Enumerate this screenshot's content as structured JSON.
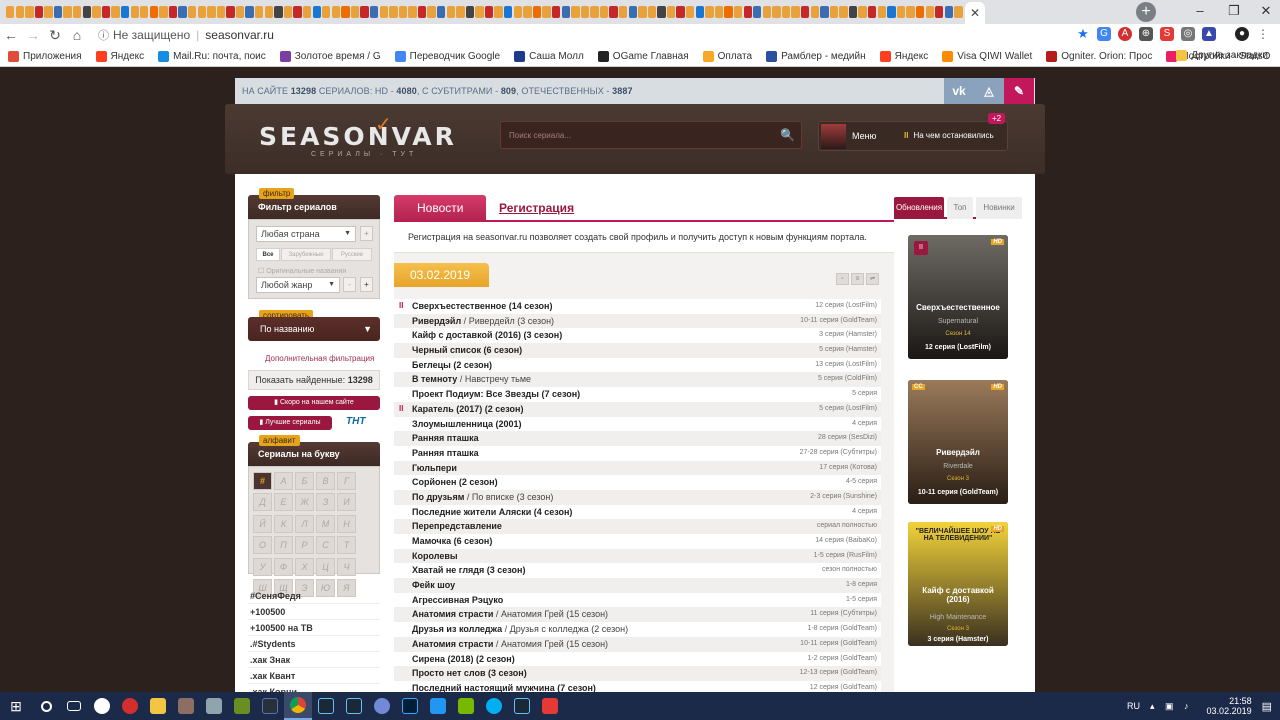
{
  "browser": {
    "url": "seasonvar.ru",
    "insecure_label": "Не защищено",
    "bookmarks": [
      {
        "label": "Приложения",
        "color": "#e04b3a"
      },
      {
        "label": "Яндекс",
        "color": "#fc3f1d"
      },
      {
        "label": "Mail.Ru: почта, поис",
        "color": "#168de2"
      },
      {
        "label": "Золотое время / G",
        "color": "#7a3ea3"
      },
      {
        "label": "Переводчик Google",
        "color": "#4285f4"
      },
      {
        "label": "Саша Молл",
        "color": "#1e3a8a"
      },
      {
        "label": "OGame Главная",
        "color": "#222"
      },
      {
        "label": "Оплата",
        "color": "#f9a825"
      },
      {
        "label": "Рамблер - медийн",
        "color": "#2b4fa0"
      },
      {
        "label": "Яндекс",
        "color": "#fc3f1d"
      },
      {
        "label": "Visa QIWI Wallet",
        "color": "#ff8c00"
      },
      {
        "label": "Ogniter. Orion: Прос",
        "color": "#b71c1c"
      },
      {
        "label": "Постройки - StarsO",
        "color": "#e91e63"
      }
    ],
    "other_bookmarks": "Другие закладки"
  },
  "site": {
    "stats": {
      "prefix": "НА САЙТЕ",
      "total": "13298",
      "t1": "СЕРИАЛОВ: HD -",
      "hd": "4080",
      "t2": ", С СУБТИТРАМИ -",
      "subs": "809",
      "t3": ", ОТЕЧЕСТВЕННЫХ -",
      "domestic": "3887"
    },
    "logo": "SEASONVAR",
    "logo_sub": "СЕРИАЛЫ · ТУТ",
    "search_placeholder": "Поиск сериала...",
    "menu_label": "Меню",
    "stopped_label": "На чем остановились",
    "badge": "+2"
  },
  "sidebar": {
    "filter_tag": "фильтр",
    "filter_title": "Фильтр сериалов",
    "country_select": "Любая страна",
    "seg_all": "Все",
    "seg_foreign": "Зарубежные",
    "seg_russian": "Русские",
    "original_names": "Оригинальные названия",
    "genre_select": "Любой жанр",
    "sort_tag": "сортировать",
    "sort_value": "По названию",
    "advanced_filter": "Дополнительная фильтрация",
    "found_label": "Показать найденные:",
    "found_count": "13298",
    "soon_button": "Скоро на нашем сайте",
    "best_button": "Лучшие сериалы",
    "tnt": "ТНТ",
    "alpha_tag": "алфавит",
    "alpha_title": "Сериалы на букву",
    "letters": [
      "#",
      "А",
      "Б",
      "В",
      "Г",
      "Д",
      "Е",
      "Ж",
      "З",
      "И",
      "Й",
      "К",
      "Л",
      "М",
      "Н",
      "О",
      "П",
      "Р",
      "С",
      "Т",
      "У",
      "Ф",
      "Х",
      "Ц",
      "Ч",
      "Ш",
      "Щ",
      "Э",
      "Ю",
      "Я"
    ],
    "tags": [
      "#СеняФедя",
      "+100500",
      "+100500 на ТВ",
      ".#Stydents",
      ".хак Знак",
      ".хак Квант",
      ".хак Корни"
    ]
  },
  "center": {
    "tab_news": "Новости",
    "tab_registration": "Регистрация",
    "registration_text": "Регистрация на seasonvar.ru позволяет создать свой профиль и получить доступ к новым функциям портала.",
    "date": "03.02.2019",
    "episodes": [
      {
        "title": "Сверхъестественное (14 сезон)",
        "alt": "",
        "info": "12 серия (LostFilm)",
        "paused": true
      },
      {
        "title": "Ривердэйл",
        "alt": "Ривердейл (3 сезон)",
        "info": "10-11 серия (GoldTeam)",
        "paused": false
      },
      {
        "title": "Кайф с доставкой (2016) (3 сезон)",
        "alt": "",
        "info": "3 серия (Hamster)",
        "paused": false
      },
      {
        "title": "Черный список (6 сезон)",
        "alt": "",
        "info": "5 серия (Hamster)",
        "paused": false
      },
      {
        "title": "Беглецы (2 сезон)",
        "alt": "",
        "info": "13 серия (LostFilm)",
        "paused": false
      },
      {
        "title": "В темноту",
        "alt": "Навстречу тьме",
        "info": "5 серия (ColdFilm)",
        "paused": false
      },
      {
        "title": "Проект Подиум: Все Звезды (7 сезон)",
        "alt": "",
        "info": "5 серия",
        "paused": false
      },
      {
        "title": "Каратель (2017) (2 сезон)",
        "alt": "",
        "info": "5 серия (LostFilm)",
        "paused": true
      },
      {
        "title": "Злоумышленница (2001)",
        "alt": "",
        "info": "4 серия",
        "paused": false
      },
      {
        "title": "Ранняя пташка",
        "alt": "",
        "info": "28 серия (SesDizi)",
        "paused": false
      },
      {
        "title": "Ранняя пташка",
        "alt": "",
        "info": "27-28 серия (Субтитры)",
        "paused": false
      },
      {
        "title": "Гюльпери",
        "alt": "",
        "info": "17 серия (Котова)",
        "paused": false
      },
      {
        "title": "Сорйонен (2 сезон)",
        "alt": "",
        "info": "4-5 серия",
        "paused": false
      },
      {
        "title": "По друзьям",
        "alt": "По вписке (3 сезон)",
        "info": "2-3 серия (Sunshine)",
        "paused": false
      },
      {
        "title": "Последние жители Аляски (4 сезон)",
        "alt": "",
        "info": "4 серия",
        "paused": false
      },
      {
        "title": "Перепредставление",
        "alt": "",
        "info": "сериал полностью",
        "paused": false
      },
      {
        "title": "Мамочка (6 сезон)",
        "alt": "",
        "info": "14 серия (BaibaKo)",
        "paused": false
      },
      {
        "title": "Королевы",
        "alt": "",
        "info": "1-5 серия (RusFilm)",
        "paused": false
      },
      {
        "title": "Хватай не глядя (3 сезон)",
        "alt": "",
        "info": "сезон полностью",
        "paused": false
      },
      {
        "title": "Фейк шоу",
        "alt": "",
        "info": "1-8 серия",
        "paused": false
      },
      {
        "title": "Агрессивная Рэцуко",
        "alt": "",
        "info": "1-5 серия",
        "paused": false
      },
      {
        "title": "Анатомия страсти",
        "alt": "Анатомия Грей (15 сезон)",
        "info": "11 серия (Субтитры)",
        "paused": false
      },
      {
        "title": "Друзья из колледжа",
        "alt": "Друзья с колледжа (2 сезон)",
        "info": "1-8 серия (GoldTeam)",
        "paused": false
      },
      {
        "title": "Анатомия страсти",
        "alt": "Анатомия Грей (15 сезон)",
        "info": "10-11 серия (GoldTeam)",
        "paused": false
      },
      {
        "title": "Сирена (2018) (2 сезон)",
        "alt": "",
        "info": "1-2 серия (GoldTeam)",
        "paused": false
      },
      {
        "title": "Просто нет слов (3 сезон)",
        "alt": "",
        "info": "12-13 серия (GoldTeam)",
        "paused": false
      },
      {
        "title": "Последний настоящий мужчина (7 сезон)",
        "alt": "",
        "info": "12 серия (GoldTeam)",
        "paused": false
      }
    ]
  },
  "right": {
    "tabs": [
      "Обновления",
      "Топ",
      "Новинки"
    ],
    "cards": [
      {
        "title": "Сверхъестественное",
        "sub": "Supernatural",
        "season": "Сезон 14",
        "ep": "12 серия (LostFilm)",
        "hd": "HD",
        "cc": "",
        "paused": true,
        "bg1": "#6e6a64",
        "bg2": "#1b1714"
      },
      {
        "title": "Ривердэйл",
        "sub": "Riverdale",
        "season": "Сезон 3",
        "ep": "10-11 серия (GoldTeam)",
        "hd": "HD",
        "cc": "CC",
        "paused": false,
        "bg1": "#9a7a5a",
        "bg2": "#2a1e16"
      },
      {
        "title": "Кайф с доставкой (2016)",
        "sub": "High Maintenance",
        "season": "Сезон 3",
        "ep": "3 серия (Hamster)",
        "hd": "HD",
        "cc": "",
        "paused": false,
        "bg1": "#f2d33a",
        "bg2": "#3a3020",
        "poster_text": "\"ВЕЛИЧАЙШЕЕ ШОУ НЕ НА ТЕЛЕВИДЕНИИ\""
      }
    ]
  },
  "taskbar": {
    "lang": "RU",
    "time": "21:58",
    "date": "03.02.2019"
  }
}
